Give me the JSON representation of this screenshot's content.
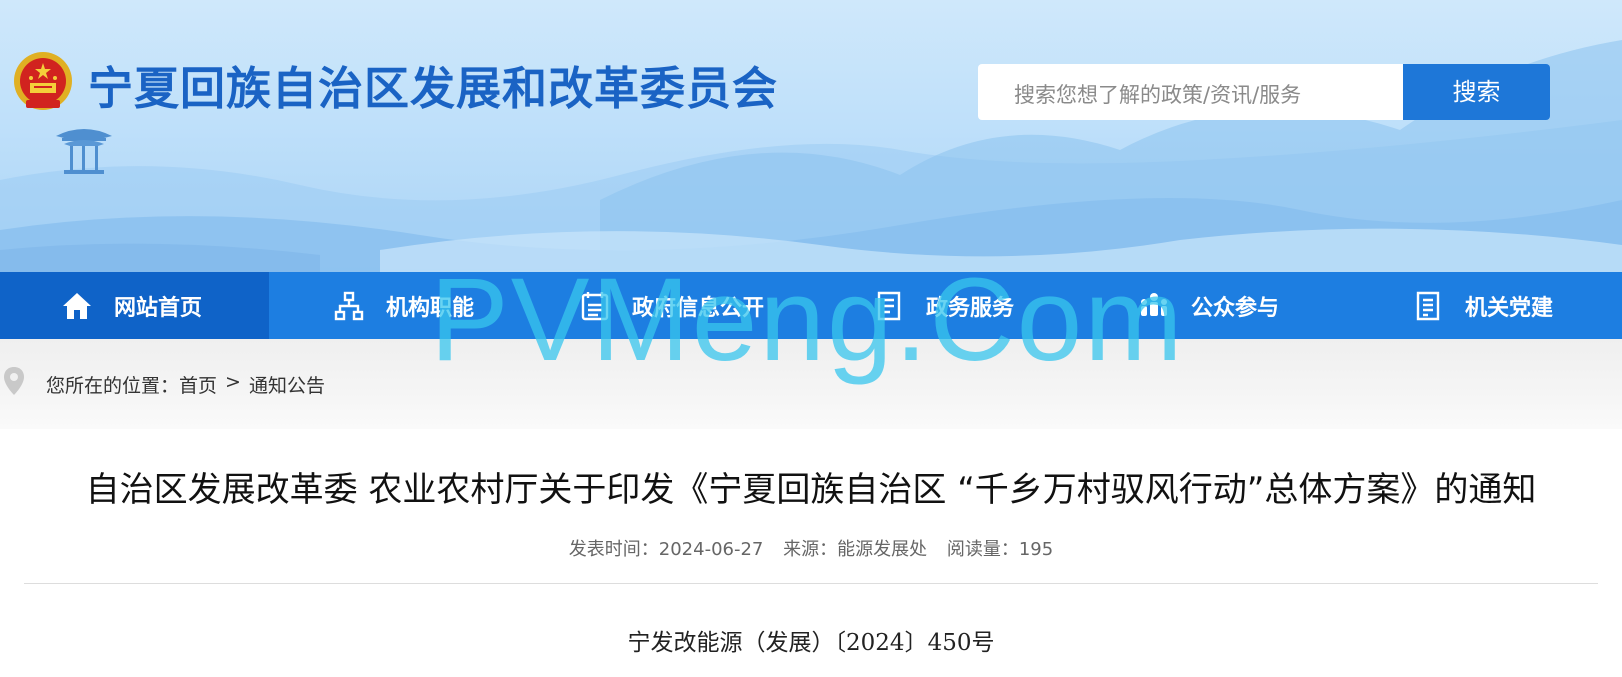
{
  "header": {
    "site_title": "宁夏回族自治区发展和改革委员会",
    "search": {
      "placeholder": "搜索您想了解的政策/资讯/服务",
      "button_label": "搜索"
    }
  },
  "nav": {
    "items": [
      {
        "label": "网站首页",
        "icon": "home-icon",
        "active": true
      },
      {
        "label": "机构职能",
        "icon": "org-chart-icon"
      },
      {
        "label": "政府信息公开",
        "icon": "calendar-list-icon"
      },
      {
        "label": "政务服务",
        "icon": "document-icon"
      },
      {
        "label": "公众参与",
        "icon": "people-icon"
      },
      {
        "label": "机关党建",
        "icon": "document-list-icon"
      }
    ]
  },
  "breadcrumb": {
    "prefix": "您所在的位置：",
    "items": [
      "首页",
      "通知公告"
    ],
    "separator": ">"
  },
  "article": {
    "title": "自治区发展改革委 农业农村厅关于印发《宁夏回族自治区 “千乡万村驭风行动”总体方案》的通知",
    "meta": {
      "publish_time": "发表时间：2024-06-27",
      "source": "来源：能源发展处",
      "views": "阅读量：195"
    },
    "doc_number": "宁发改能源（发展）〔2024〕450号"
  },
  "watermark": "PVMeng.Com",
  "colors": {
    "brand_blue": "#1d7ee1",
    "nav_active": "#0f63c8",
    "search_button": "#1e77d8",
    "title_blue": "#1a63c4",
    "watermark": "#38c6ee"
  }
}
